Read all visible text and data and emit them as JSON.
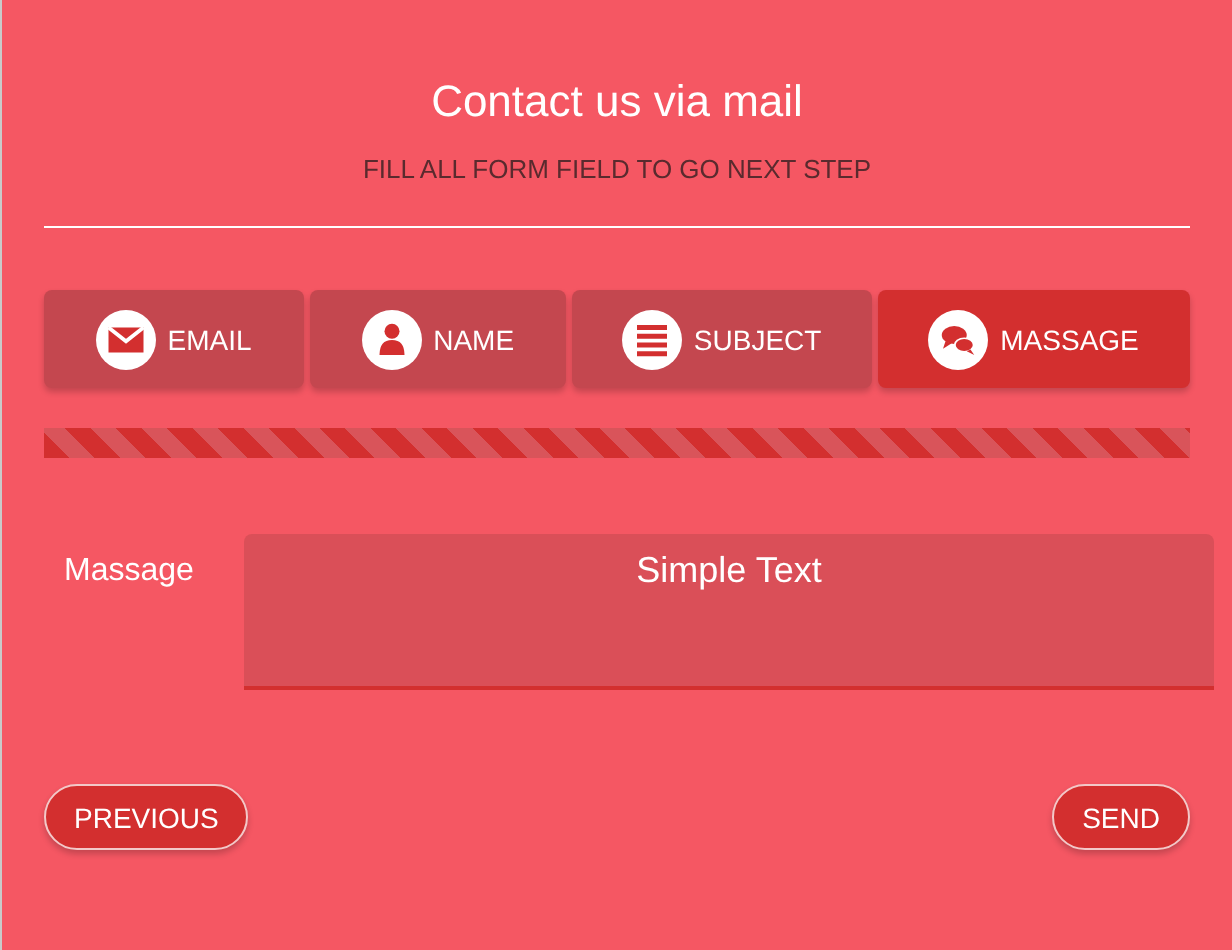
{
  "header": {
    "title": "Contact us via mail",
    "subtitle": "FILL ALL FORM FIELD TO GO NEXT STEP"
  },
  "steps": [
    {
      "label": "EMAIL",
      "kind": "email",
      "selected": false
    },
    {
      "label": "NAME",
      "kind": "name",
      "selected": false
    },
    {
      "label": "SUBJECT",
      "kind": "subject",
      "selected": false
    },
    {
      "label": "MASSAGE",
      "kind": "message",
      "selected": true
    }
  ],
  "progress": {
    "level": 1
  },
  "field": {
    "label": "Massage",
    "value": "Simple Text"
  },
  "buttons": {
    "previous": "PREVIOUS",
    "send": "SEND"
  }
}
